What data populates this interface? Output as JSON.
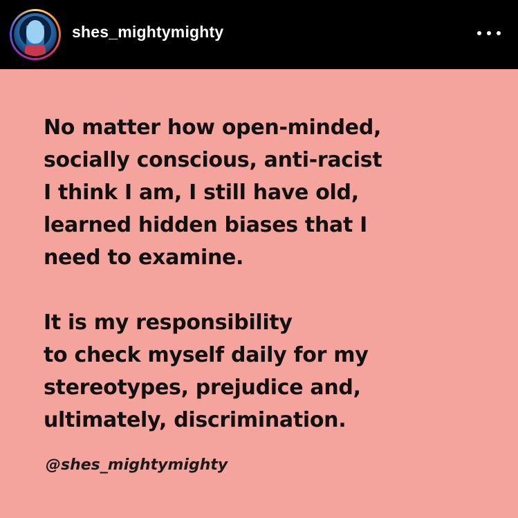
{
  "header": {
    "username": "shes_mightymighty",
    "avatar_icon": "profile-avatar",
    "more_icon": "more-options-icon"
  },
  "post": {
    "background_color": "#f5a39d",
    "paragraph1": [
      "No matter how open-minded,",
      "socially conscious, anti-racist",
      "I think I am, I still have old,",
      "learned hidden biases that I",
      "need to examine."
    ],
    "paragraph2": [
      "It is my responsibility",
      "to check myself daily for my",
      "stereotypes, prejudice and,",
      "ultimately, discrimination."
    ],
    "handle": "@shes_mightymighty"
  }
}
